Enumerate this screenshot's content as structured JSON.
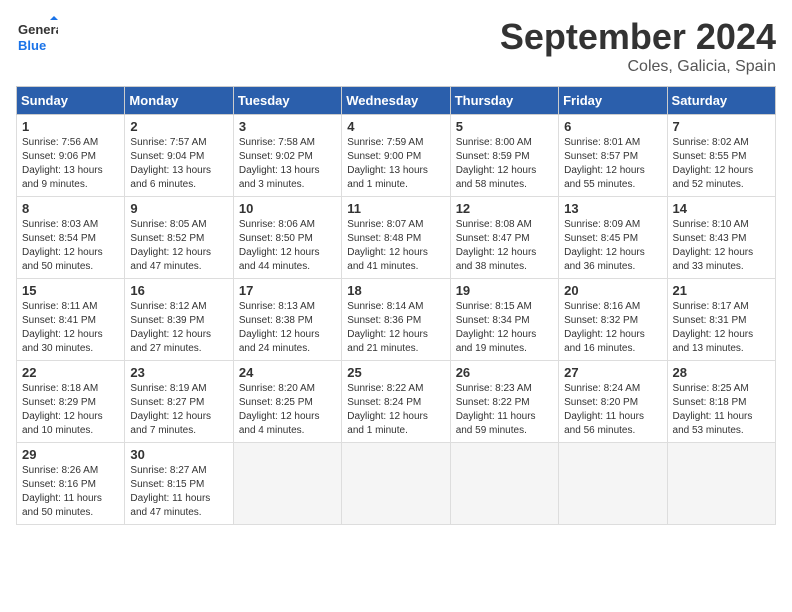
{
  "header": {
    "logo_general": "General",
    "logo_blue": "Blue",
    "month_year": "September 2024",
    "location": "Coles, Galicia, Spain"
  },
  "days_of_week": [
    "Sunday",
    "Monday",
    "Tuesday",
    "Wednesday",
    "Thursday",
    "Friday",
    "Saturday"
  ],
  "weeks": [
    [
      {
        "day": "1",
        "info": "Sunrise: 7:56 AM\nSunset: 9:06 PM\nDaylight: 13 hours and 9 minutes."
      },
      {
        "day": "2",
        "info": "Sunrise: 7:57 AM\nSunset: 9:04 PM\nDaylight: 13 hours and 6 minutes."
      },
      {
        "day": "3",
        "info": "Sunrise: 7:58 AM\nSunset: 9:02 PM\nDaylight: 13 hours and 3 minutes."
      },
      {
        "day": "4",
        "info": "Sunrise: 7:59 AM\nSunset: 9:00 PM\nDaylight: 13 hours and 1 minute."
      },
      {
        "day": "5",
        "info": "Sunrise: 8:00 AM\nSunset: 8:59 PM\nDaylight: 12 hours and 58 minutes."
      },
      {
        "day": "6",
        "info": "Sunrise: 8:01 AM\nSunset: 8:57 PM\nDaylight: 12 hours and 55 minutes."
      },
      {
        "day": "7",
        "info": "Sunrise: 8:02 AM\nSunset: 8:55 PM\nDaylight: 12 hours and 52 minutes."
      }
    ],
    [
      {
        "day": "8",
        "info": "Sunrise: 8:03 AM\nSunset: 8:54 PM\nDaylight: 12 hours and 50 minutes."
      },
      {
        "day": "9",
        "info": "Sunrise: 8:05 AM\nSunset: 8:52 PM\nDaylight: 12 hours and 47 minutes."
      },
      {
        "day": "10",
        "info": "Sunrise: 8:06 AM\nSunset: 8:50 PM\nDaylight: 12 hours and 44 minutes."
      },
      {
        "day": "11",
        "info": "Sunrise: 8:07 AM\nSunset: 8:48 PM\nDaylight: 12 hours and 41 minutes."
      },
      {
        "day": "12",
        "info": "Sunrise: 8:08 AM\nSunset: 8:47 PM\nDaylight: 12 hours and 38 minutes."
      },
      {
        "day": "13",
        "info": "Sunrise: 8:09 AM\nSunset: 8:45 PM\nDaylight: 12 hours and 36 minutes."
      },
      {
        "day": "14",
        "info": "Sunrise: 8:10 AM\nSunset: 8:43 PM\nDaylight: 12 hours and 33 minutes."
      }
    ],
    [
      {
        "day": "15",
        "info": "Sunrise: 8:11 AM\nSunset: 8:41 PM\nDaylight: 12 hours and 30 minutes."
      },
      {
        "day": "16",
        "info": "Sunrise: 8:12 AM\nSunset: 8:39 PM\nDaylight: 12 hours and 27 minutes."
      },
      {
        "day": "17",
        "info": "Sunrise: 8:13 AM\nSunset: 8:38 PM\nDaylight: 12 hours and 24 minutes."
      },
      {
        "day": "18",
        "info": "Sunrise: 8:14 AM\nSunset: 8:36 PM\nDaylight: 12 hours and 21 minutes."
      },
      {
        "day": "19",
        "info": "Sunrise: 8:15 AM\nSunset: 8:34 PM\nDaylight: 12 hours and 19 minutes."
      },
      {
        "day": "20",
        "info": "Sunrise: 8:16 AM\nSunset: 8:32 PM\nDaylight: 12 hours and 16 minutes."
      },
      {
        "day": "21",
        "info": "Sunrise: 8:17 AM\nSunset: 8:31 PM\nDaylight: 12 hours and 13 minutes."
      }
    ],
    [
      {
        "day": "22",
        "info": "Sunrise: 8:18 AM\nSunset: 8:29 PM\nDaylight: 12 hours and 10 minutes."
      },
      {
        "day": "23",
        "info": "Sunrise: 8:19 AM\nSunset: 8:27 PM\nDaylight: 12 hours and 7 minutes."
      },
      {
        "day": "24",
        "info": "Sunrise: 8:20 AM\nSunset: 8:25 PM\nDaylight: 12 hours and 4 minutes."
      },
      {
        "day": "25",
        "info": "Sunrise: 8:22 AM\nSunset: 8:24 PM\nDaylight: 12 hours and 1 minute."
      },
      {
        "day": "26",
        "info": "Sunrise: 8:23 AM\nSunset: 8:22 PM\nDaylight: 11 hours and 59 minutes."
      },
      {
        "day": "27",
        "info": "Sunrise: 8:24 AM\nSunset: 8:20 PM\nDaylight: 11 hours and 56 minutes."
      },
      {
        "day": "28",
        "info": "Sunrise: 8:25 AM\nSunset: 8:18 PM\nDaylight: 11 hours and 53 minutes."
      }
    ],
    [
      {
        "day": "29",
        "info": "Sunrise: 8:26 AM\nSunset: 8:16 PM\nDaylight: 11 hours and 50 minutes."
      },
      {
        "day": "30",
        "info": "Sunrise: 8:27 AM\nSunset: 8:15 PM\nDaylight: 11 hours and 47 minutes."
      },
      {
        "day": "",
        "info": ""
      },
      {
        "day": "",
        "info": ""
      },
      {
        "day": "",
        "info": ""
      },
      {
        "day": "",
        "info": ""
      },
      {
        "day": "",
        "info": ""
      }
    ]
  ]
}
